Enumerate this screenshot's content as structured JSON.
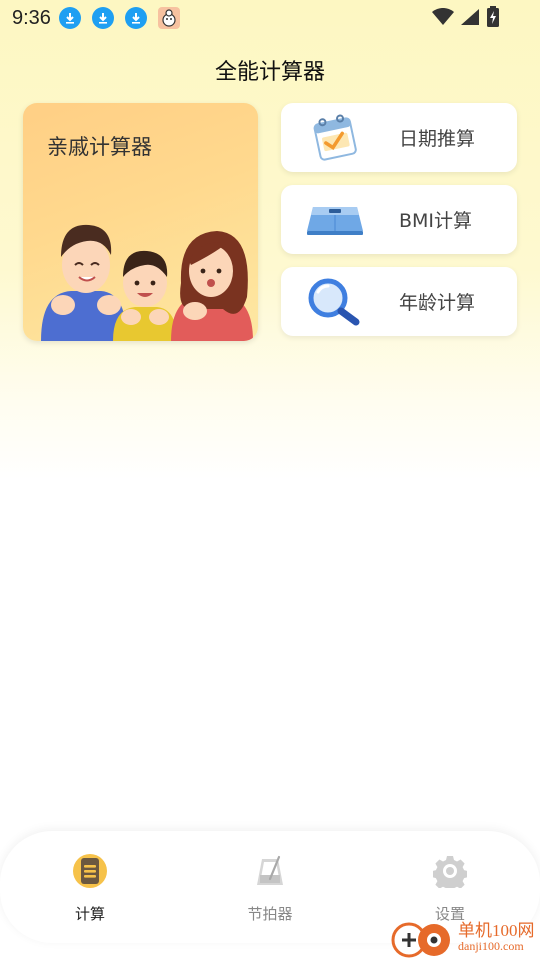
{
  "status_bar": {
    "time": "9:36",
    "notifications": [
      "download-icon",
      "download-icon",
      "download-icon",
      "app-notification-icon"
    ]
  },
  "header": {
    "title": "全能计算器"
  },
  "cards": {
    "relatives": {
      "label": "亲戚计算器"
    },
    "date": {
      "label": "日期推算"
    },
    "bmi": {
      "label": "BMI计算"
    },
    "age": {
      "label": "年龄计算"
    }
  },
  "bottom_nav": {
    "items": [
      {
        "label": "计算",
        "icon": "calculator-icon",
        "active": true
      },
      {
        "label": "节拍器",
        "icon": "metronome-icon",
        "active": false
      },
      {
        "label": "设置",
        "icon": "gear-icon",
        "active": false
      }
    ]
  },
  "watermark": {
    "main": "单机100网",
    "sub": "danji100.com"
  },
  "colors": {
    "accent": "#f6c24a",
    "card_gradient_top": "#ffcf85",
    "download_blue": "#1e9ff2"
  }
}
